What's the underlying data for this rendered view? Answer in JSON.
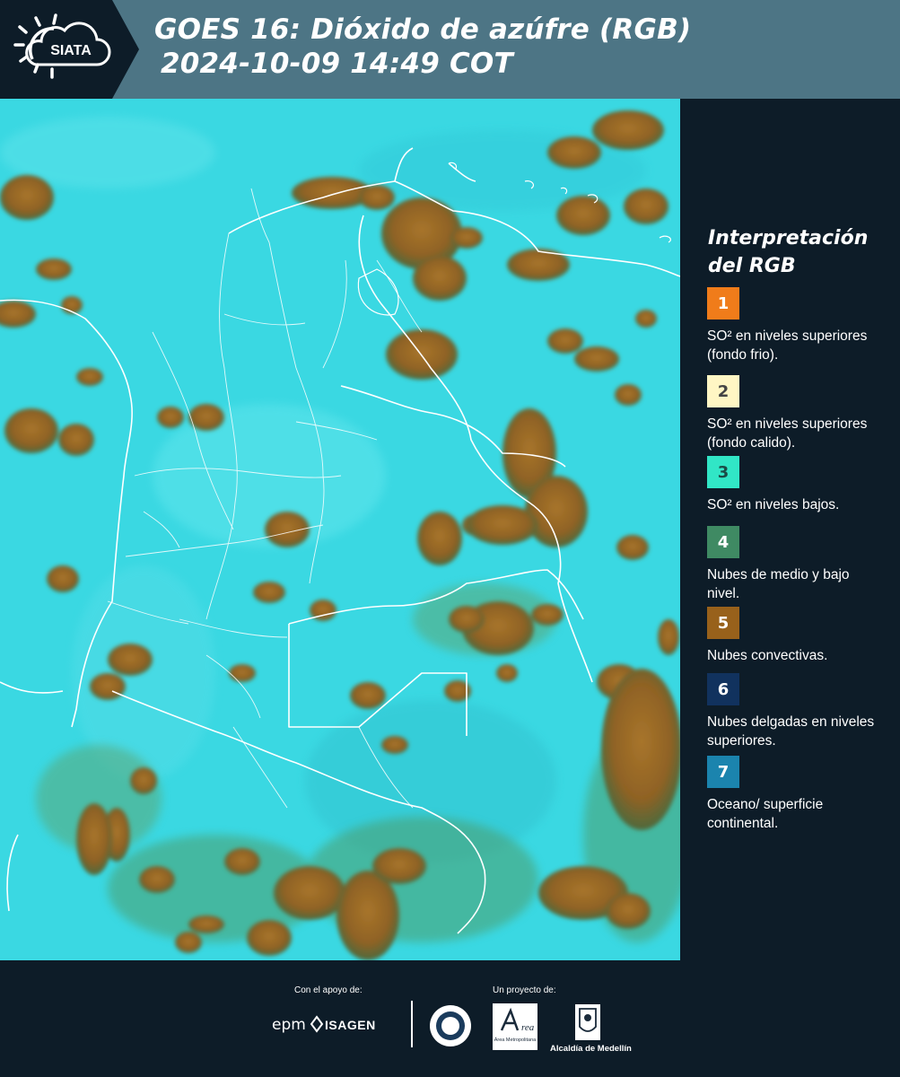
{
  "header": {
    "logo_text": "SIATA",
    "title_line1": "GOES 16: Dióxido de azúfre (RGB)",
    "title_line2": "2024-10-09 14:49 COT"
  },
  "legend": {
    "title": "Interpretación del RGB",
    "items": [
      {
        "num": "1",
        "color": "#f07c1a",
        "num_color": "#ffffff",
        "text": "SO² en niveles superiores (fondo frio)."
      },
      {
        "num": "2",
        "color": "#fff6c4",
        "num_color": "#444444",
        "text": "SO² en niveles superiores (fondo calido)."
      },
      {
        "num": "3",
        "color": "#31e6c6",
        "num_color": "#1b4b46",
        "text": "SO² en niveles bajos."
      },
      {
        "num": "4",
        "color": "#3f8a63",
        "num_color": "#ffffff",
        "text": "Nubes de medio y bajo nivel."
      },
      {
        "num": "5",
        "color": "#98611b",
        "num_color": "#ffffff",
        "text": "Nubes convectivas."
      },
      {
        "num": "6",
        "color": "#11325e",
        "num_color": "#ffffff",
        "text": "Nubes delgadas en niveles superiores."
      },
      {
        "num": "7",
        "color": "#1b84ae",
        "num_color": "#ffffff",
        "text": "Oceano/ superficie continental."
      }
    ]
  },
  "footer": {
    "support_label": "Con el apoyo de:",
    "project_label": "Un proyecto de:",
    "epm": "epm",
    "isagen": "ISAGEN",
    "area_metro": "Área Metropolitana",
    "alcaldia": "Alcaldía de Medellín"
  },
  "colors": {
    "header_bg": "#4d7585",
    "panel_bg": "#0d1c28",
    "map_base": "#3ad8e2",
    "cloud_convective": "#9b6b22"
  }
}
